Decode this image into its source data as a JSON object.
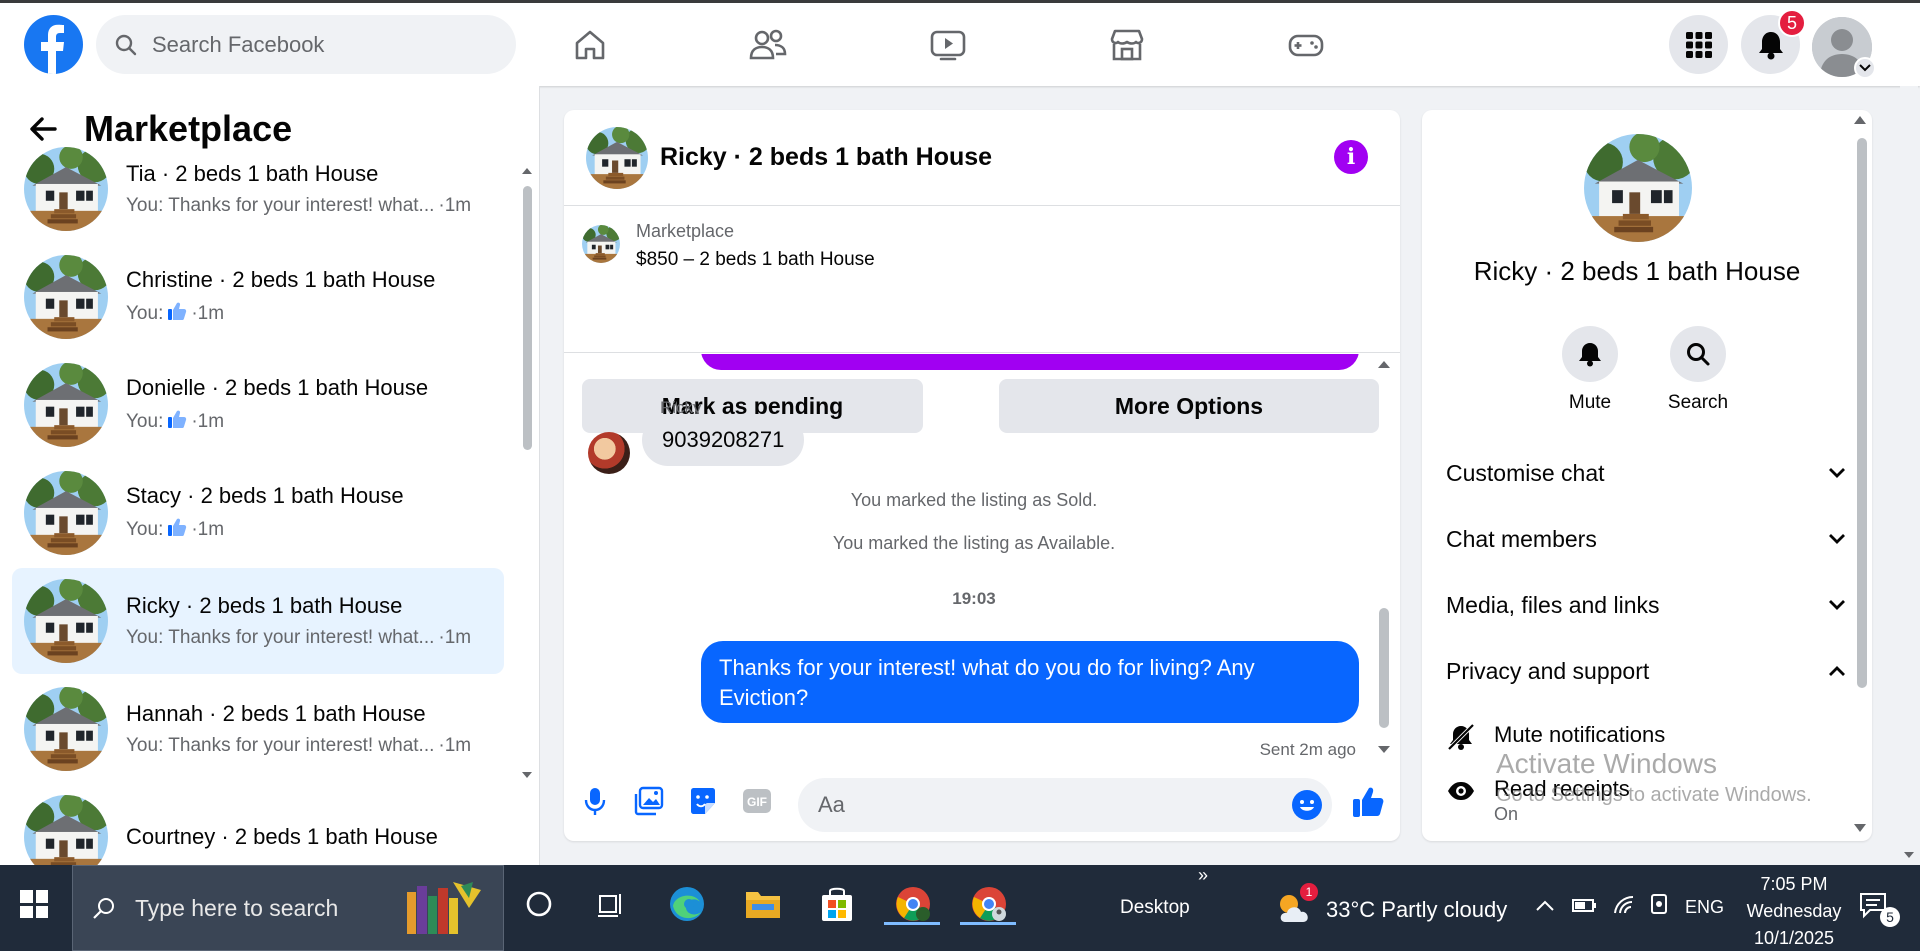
{
  "topbar": {
    "search_placeholder": "Search Facebook",
    "notifications_count": "5",
    "nav_icons": [
      "home-icon",
      "friends-icon",
      "watch-icon",
      "marketplace-icon",
      "gaming-icon"
    ]
  },
  "left": {
    "title": "Marketplace",
    "conversations": [
      {
        "title": "Tia · 2 beds 1 bath House",
        "preview": "You: Thanks for your interest! what...",
        "time": "·1m",
        "liked": false
      },
      {
        "title": "Christine · 2 beds 1 bath House",
        "preview": "You:",
        "time": "·1m",
        "liked": true
      },
      {
        "title": "Donielle · 2 beds 1 bath House",
        "preview": "You:",
        "time": "·1m",
        "liked": true
      },
      {
        "title": "Stacy · 2 beds 1 bath House",
        "preview": "You:",
        "time": "·1m",
        "liked": true
      },
      {
        "title": "Ricky · 2 beds 1 bath House",
        "preview": "You: Thanks for your interest! what...",
        "time": "·1m",
        "liked": false,
        "active": true
      },
      {
        "title": "Hannah · 2 beds 1 bath House",
        "preview": "You: Thanks for your interest! what...",
        "time": "·1m",
        "liked": false
      },
      {
        "title": "Courtney · 2 beds 1 bath House",
        "preview": "",
        "time": "",
        "liked": false
      }
    ]
  },
  "chat": {
    "title": "Ricky · 2 beds 1 bath House",
    "listing_label": "Marketplace",
    "listing_price": "$850 – 2 beds 1 bath House",
    "mark_pending": "Mark as pending",
    "more_options": "More Options",
    "sender": "Ricky",
    "incoming_message": "9039208271",
    "system_sold": "You marked the listing as Sold.",
    "system_available": "You marked the listing as Available.",
    "time_separator": "19:03",
    "outgoing_message": "Thanks for your interest! what do you do for living? Any Eviction?",
    "sent_note": "Sent 2m ago",
    "composer_placeholder": "Aa"
  },
  "right": {
    "title": "Ricky · 2 beds 1 bath House",
    "mute_label": "Mute",
    "search_label": "Search",
    "sections": [
      "Customise chat",
      "Chat members",
      "Media, files and links",
      "Privacy and support"
    ],
    "mute_notifications": "Mute notifications",
    "read_receipts": "Read receipts",
    "read_receipts_state": "On"
  },
  "watermark": {
    "line1": "Activate Windows",
    "line2": "Go to Settings to activate Windows."
  },
  "taskbar": {
    "search_placeholder": "Type here to search",
    "desktop_label": "Desktop",
    "weather": "33°C  Partly cloudy",
    "weather_alert": "1",
    "language": "ENG",
    "time": "7:05 PM",
    "day": "Wednesday",
    "date": "10/1/2025",
    "notification_count": "5"
  },
  "colors": {
    "brand": "#1877f2",
    "messenger_blue": "#0866ff",
    "accent_purple": "#a100f2",
    "badge_red": "#e41e3f"
  }
}
